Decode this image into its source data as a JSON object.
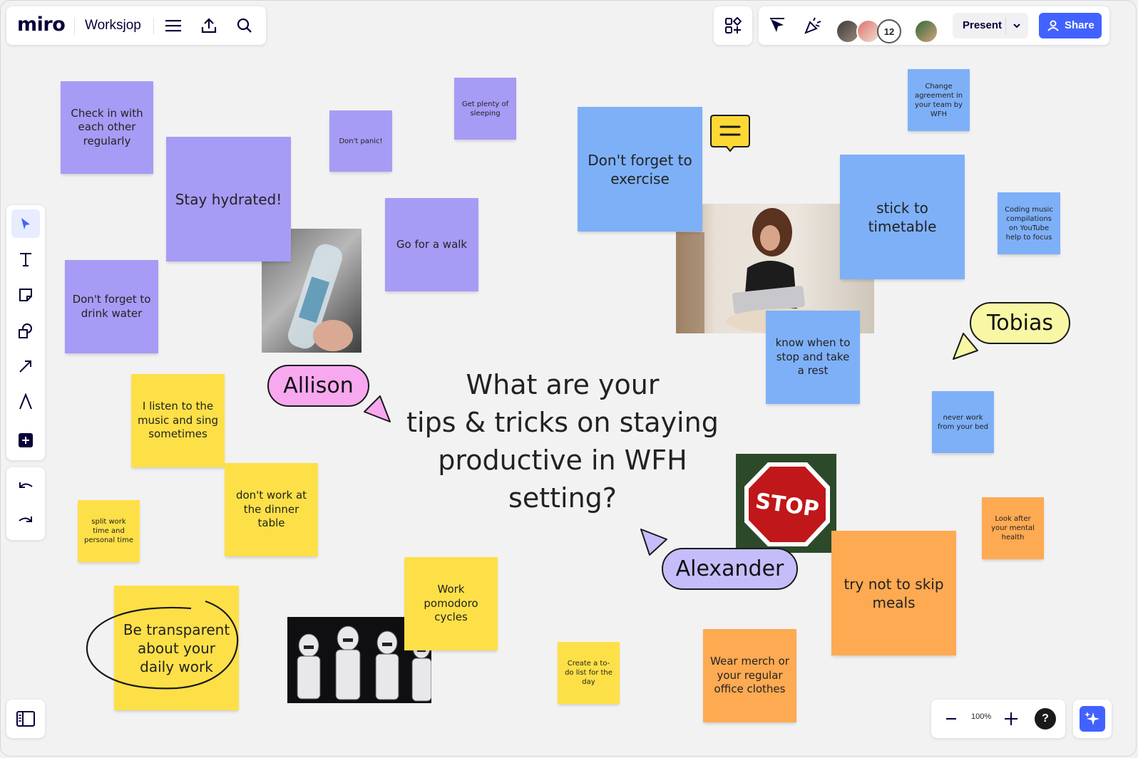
{
  "app": {
    "logo": "miro",
    "board_name": "Worksjop",
    "collaborator_count": "12",
    "present_label": "Present",
    "share_label": "Share",
    "zoom_level": "100%",
    "accent_color": "#4262ff"
  },
  "toolbar": {
    "top_icons": [
      "menu-icon",
      "upload-icon",
      "search-icon"
    ],
    "right_icons": [
      "apps-icon",
      "cursor-toggle-icon",
      "celebrate-icon"
    ],
    "left_tools": [
      "select-tool",
      "text-tool",
      "sticky-note-tool",
      "shapes-tool",
      "arrow-tool",
      "pen-tool",
      "add-tool"
    ],
    "history": [
      "undo-icon",
      "redo-icon"
    ]
  },
  "board": {
    "question": [
      "What are your",
      "tips & tricks on staying",
      "productive in WFH",
      "setting?"
    ],
    "notes": {
      "check_in": "Check in with each other regularly",
      "stay_hydrated": "Stay hydrated!",
      "dont_panic": "Don't panic!",
      "plenty_sleep": "Get plenty of sleeping",
      "go_walk": "Go for a walk",
      "drink_water": "Don't forget to drink water",
      "exercise": "Don't forget to exercise",
      "change_agreement": "Change agreement  in your team by WFH",
      "timetable": "stick to timetable",
      "coding_music": "Coding music compilations on YouTube help to focus",
      "know_when": "know when to stop and take a rest",
      "never_bed": "never work from your bed",
      "listen_music": "I listen to the music and sing sometimes",
      "dinner_table": "don't work at the dinner table",
      "split_time": "split work time and personal time",
      "transparent": "Be transparent about your daily work",
      "pomodoro": "Work pomodoro cycles",
      "todo_list": "Create a to-do list for the day",
      "wear_merch": "Wear merch or your regular office clothes",
      "skip_meals": "try not to skip meals",
      "mental_health": "Look after your mental health"
    },
    "cursors": {
      "allison": "Allison",
      "tobias": "Tobias",
      "alexander": "Alexander"
    },
    "stop_sign_text": "STOP"
  }
}
